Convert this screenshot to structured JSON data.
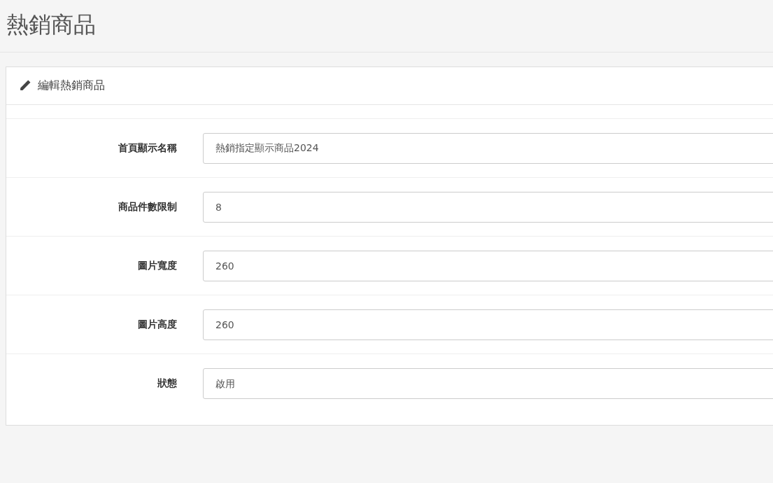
{
  "page_title": "熱銷商品",
  "panel": {
    "title": "編輯熱銷商品"
  },
  "fields": [
    {
      "label": "首頁顯示名稱",
      "kind": "text",
      "value": "熱銷指定顯示商品2024"
    },
    {
      "label": "商品件數限制",
      "kind": "text",
      "value": "8"
    },
    {
      "label": "圖片寬度",
      "kind": "text",
      "value": "260"
    },
    {
      "label": "圖片高度",
      "kind": "text",
      "value": "260"
    },
    {
      "label": "狀態",
      "kind": "select",
      "value": "啟用"
    }
  ]
}
